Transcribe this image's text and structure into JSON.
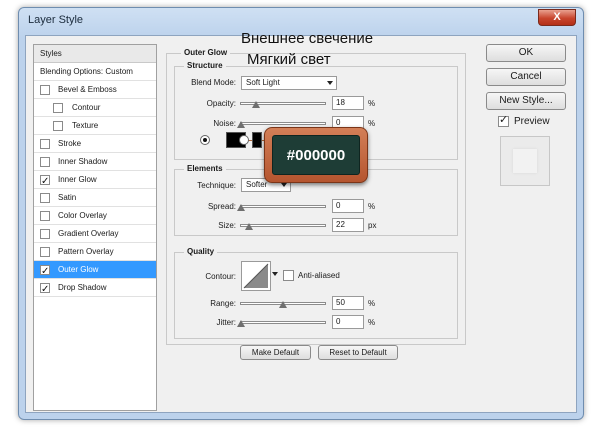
{
  "window": {
    "title": "Layer Style",
    "close_label": "X"
  },
  "styles_list": {
    "header": "Styles",
    "items": [
      {
        "label": "Blending Options: Custom",
        "checkbox": false,
        "checked": false,
        "selected": false
      },
      {
        "label": "Bevel & Emboss",
        "checkbox": true,
        "checked": false,
        "selected": false
      },
      {
        "label": "Contour",
        "checkbox": true,
        "checked": false,
        "selected": false,
        "indent": true
      },
      {
        "label": "Texture",
        "checkbox": true,
        "checked": false,
        "selected": false,
        "indent": true
      },
      {
        "label": "Stroke",
        "checkbox": true,
        "checked": false,
        "selected": false
      },
      {
        "label": "Inner Shadow",
        "checkbox": true,
        "checked": false,
        "selected": false
      },
      {
        "label": "Inner Glow",
        "checkbox": true,
        "checked": true,
        "selected": false
      },
      {
        "label": "Satin",
        "checkbox": true,
        "checked": false,
        "selected": false
      },
      {
        "label": "Color Overlay",
        "checkbox": true,
        "checked": false,
        "selected": false
      },
      {
        "label": "Gradient Overlay",
        "checkbox": true,
        "checked": false,
        "selected": false
      },
      {
        "label": "Pattern Overlay",
        "checkbox": true,
        "checked": false,
        "selected": false
      },
      {
        "label": "Outer Glow",
        "checkbox": true,
        "checked": true,
        "selected": true
      },
      {
        "label": "Drop Shadow",
        "checkbox": true,
        "checked": true,
        "selected": false
      }
    ]
  },
  "panel": {
    "title": "Outer Glow",
    "structure": {
      "label": "Structure",
      "blend_mode_label": "Blend Mode:",
      "blend_mode_value": "Soft Light",
      "opacity_label": "Opacity:",
      "opacity_value": "18",
      "opacity_level": 0.18,
      "noise_label": "Noise:",
      "noise_value": "0",
      "noise_level": 0,
      "unit": "%"
    },
    "elements": {
      "label": "Elements",
      "technique_label": "Technique:",
      "technique_value": "Softer",
      "spread_label": "Spread:",
      "spread_value": "0",
      "spread_level": 0,
      "size_label": "Size:",
      "size_value": "22",
      "size_level": 0.09,
      "spread_unit": "%",
      "size_unit": "px"
    },
    "quality": {
      "label": "Quality",
      "contour_label": "Contour:",
      "anti_aliased_label": "Anti-aliased",
      "anti_aliased_checked": false,
      "range_label": "Range:",
      "range_value": "50",
      "range_level": 0.5,
      "jitter_label": "Jitter:",
      "jitter_value": "0",
      "jitter_level": 0,
      "unit": "%"
    },
    "make_default_label": "Make Default",
    "reset_default_label": "Reset to Default"
  },
  "buttons": {
    "ok": "OK",
    "cancel": "Cancel",
    "new_style": "New Style...",
    "preview_label": "Preview",
    "preview_checked": true
  },
  "overlay": {
    "ru_title": "Внешнее свечение",
    "ru_blend": "Мягкий свет",
    "hex_label": "#000000",
    "glow_color": "#000000"
  }
}
